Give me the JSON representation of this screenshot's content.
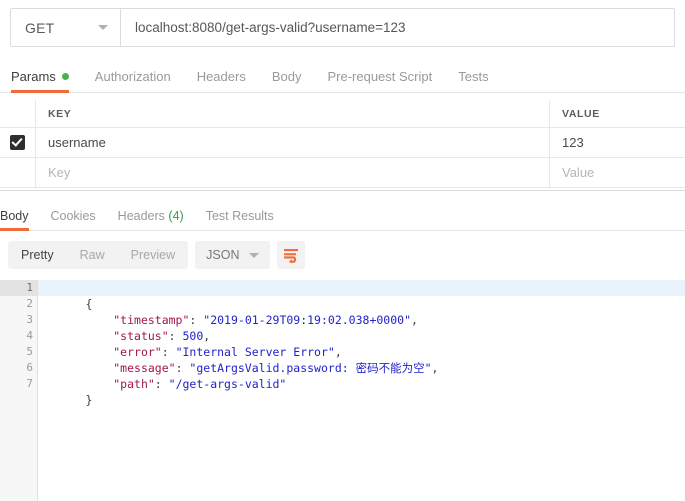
{
  "request": {
    "method": "GET",
    "url": "localhost:8080/get-args-valid?username=123"
  },
  "request_tabs": [
    {
      "label": "Params",
      "active": true,
      "badge": "dot-green"
    },
    {
      "label": "Authorization",
      "active": false
    },
    {
      "label": "Headers",
      "active": false
    },
    {
      "label": "Body",
      "active": false
    },
    {
      "label": "Pre-request Script",
      "active": false
    },
    {
      "label": "Tests",
      "active": false
    }
  ],
  "params_table": {
    "columns": [
      "KEY",
      "VALUE"
    ],
    "rows": [
      {
        "checked": true,
        "key": "username",
        "value": "123"
      },
      {
        "checked": false,
        "key": "",
        "value": "",
        "key_placeholder": "Key",
        "value_placeholder": "Value"
      }
    ]
  },
  "response_tabs": [
    {
      "label": "Body",
      "active": true
    },
    {
      "label": "Cookies",
      "active": false
    },
    {
      "label": "Headers",
      "count": "(4)",
      "active": false
    },
    {
      "label": "Test Results",
      "active": false
    }
  ],
  "format_bar": {
    "views": [
      {
        "label": "Pretty",
        "active": true
      },
      {
        "label": "Raw",
        "active": false
      },
      {
        "label": "Preview",
        "active": false
      }
    ],
    "language": "JSON",
    "wrap_icon": "word-wrap-icon"
  },
  "response_body": {
    "language": "json",
    "line_numbers": [
      "1",
      "2",
      "3",
      "4",
      "5",
      "6",
      "7"
    ],
    "raw": "{\n    \"timestamp\": \"2019-01-29T09:19:02.038+0000\",\n    \"status\": 500,\n    \"error\": \"Internal Server Error\",\n    \"message\": \"getArgsValid.password: 密码不能为空\",\n    \"path\": \"/get-args-valid\"\n}",
    "fields": {
      "timestamp": "2019-01-29T09:19:02.038+0000",
      "status": "500",
      "error": "Internal Server Error",
      "message": "getArgsValid.password: 密码不能为空",
      "path": "/get-args-valid"
    },
    "tokens": {
      "brace_open": "{",
      "brace_close": "}",
      "k_timestamp": "\"timestamp\"",
      "v_timestamp": "\"2019-01-29T09:19:02.038+0000\"",
      "k_status": "\"status\"",
      "v_status": "500",
      "k_error": "\"error\"",
      "v_error": "\"Internal Server Error\"",
      "k_message": "\"message\"",
      "v_message_ascii": "\"getArgsValid.password: ",
      "v_message_cn": "密码不能为空",
      "v_message_end": "\"",
      "k_path": "\"path\"",
      "v_path": "\"/get-args-valid\"",
      "colon": ": ",
      "comma": ",",
      "indent": "    "
    }
  },
  "colors": {
    "accent_orange": "#f26b3a",
    "green": "#4caf50",
    "json_key": "#a3174f",
    "json_string": "#2222cc",
    "active_line": "#eaf2fb"
  }
}
